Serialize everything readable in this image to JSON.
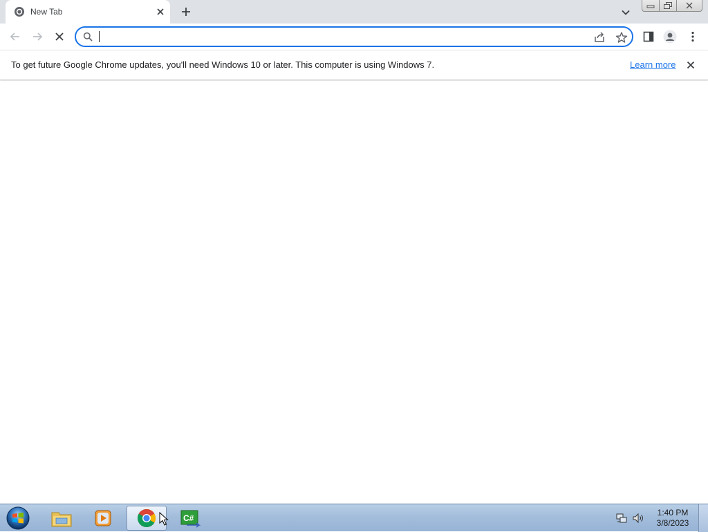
{
  "browser": {
    "tab": {
      "title": "New Tab",
      "favicon": "chrome-newtab-icon"
    },
    "new_tab_icon": "plus-icon",
    "tab_search_icon": "chevron-down-icon",
    "window_controls": [
      "minimize-icon",
      "restore-icon",
      "close-icon"
    ]
  },
  "toolbar": {
    "back_icon": "arrow-left-icon",
    "forward_icon": "arrow-right-icon",
    "stop_icon": "stop-loading-icon",
    "omnibox": {
      "value": "",
      "placeholder": ""
    },
    "share_icon": "share-icon",
    "bookmark_icon": "star-icon",
    "side_panel_icon": "side-panel-icon",
    "profile_icon": "profile-avatar-icon",
    "menu_icon": "kebab-menu-icon"
  },
  "infobar": {
    "message": "To get future Google Chrome updates, you'll need Windows 10 or later. This computer is using Windows 7.",
    "link_label": "Learn more"
  },
  "taskbar": {
    "apps": [
      "file-explorer-icon",
      "media-player-icon",
      "chrome-icon",
      "csharp-app-icon"
    ],
    "active_app": "chrome",
    "clock": {
      "time": "1:40 PM",
      "date": "3/8/2023"
    }
  },
  "colors": {
    "accent": "#1a73e8",
    "tabstrip_bg": "#dee1e6",
    "taskbar_bg": "#a3bddb"
  }
}
